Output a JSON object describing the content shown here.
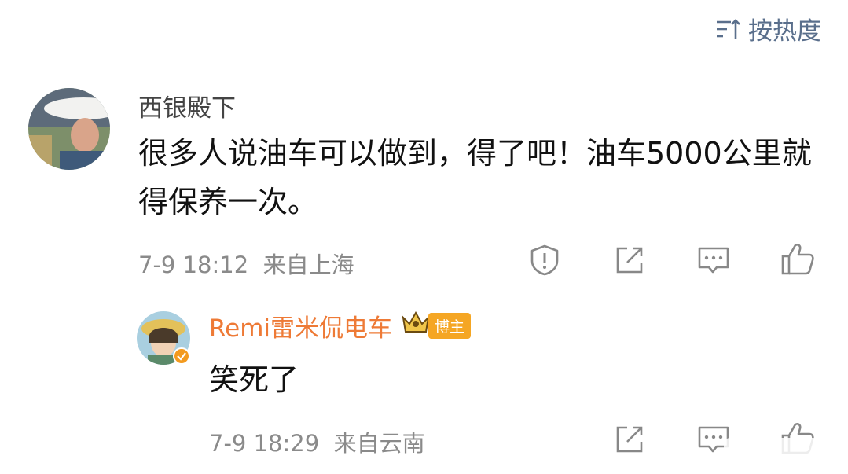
{
  "sort": {
    "label": "按热度",
    "icon": "sort-icon"
  },
  "comment": {
    "username": "西银殿下",
    "text": "很多人说油车可以做到，得了吧！油车5000公里就得保养一次。",
    "time": "7-9 18:12",
    "location": "来自上海",
    "actions": [
      "report-icon",
      "share-icon",
      "comment-icon",
      "like-icon"
    ]
  },
  "reply": {
    "username": "Remi雷米侃电车",
    "badge": "博主",
    "text": "笑死了",
    "time": "7-9 18:29",
    "location": "来自云南",
    "actions": [
      "share-icon",
      "comment-icon",
      "like-icon"
    ]
  },
  "colors": {
    "accent": "#ee7a36",
    "badge": "#f5a623",
    "meta": "#8a8a8a",
    "sort": "#5a6f8c"
  }
}
